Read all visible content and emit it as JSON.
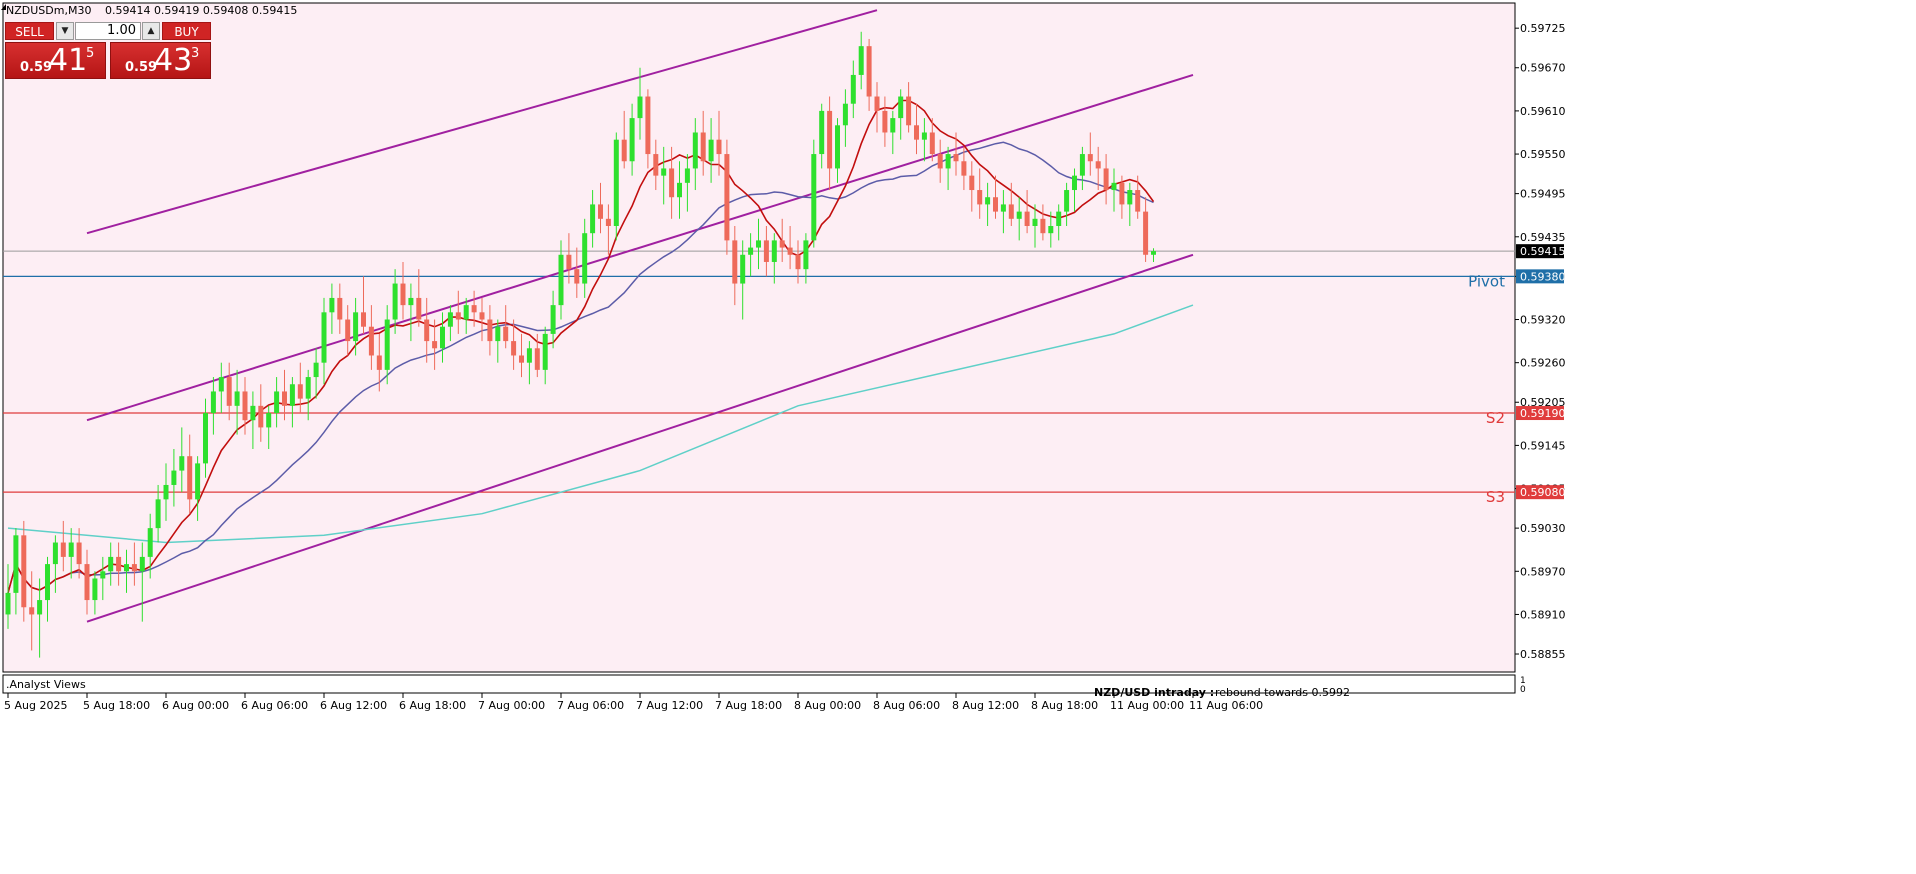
{
  "header": {
    "symbol": "NZDUSDm,M30",
    "ohlc": "0.59414 0.59419 0.59408 0.59415"
  },
  "trade_panel": {
    "sell_label": "SELL",
    "buy_label": "BUY",
    "lot": "1.00",
    "sell_small": "0.59",
    "sell_big": "41",
    "sell_sup": "5",
    "buy_small": "0.59",
    "buy_big": "43",
    "buy_sup": "3"
  },
  "footer": {
    "indicator_label": ".Analyst Views",
    "note_label": "NZD/USD intraday :",
    "note_text": "rebound towards 0.5992"
  },
  "colors": {
    "background": "#fdeef4",
    "bull": "#2ee02e",
    "bear": "#ee6a5a",
    "ma_fast": "#c20e0e",
    "ma_mid": "#5c5ca8",
    "ma_slow": "#5fd0c8",
    "channel": "#a020a0",
    "pivot": "#1f6fa8",
    "support": "#e03c3c",
    "grid_price_box": "#000000"
  },
  "chart_data": {
    "type": "candlestick",
    "symbol": "NZDUSDm",
    "timeframe": "M30",
    "ylim": [
      0.5883,
      0.5976
    ],
    "y_ticks": [
      "0.59725",
      "0.59670",
      "0.59610",
      "0.59550",
      "0.59495",
      "0.59435",
      "0.59380",
      "0.59320",
      "0.59260",
      "0.59205",
      "0.59145",
      "0.59085",
      "0.59030",
      "0.58970",
      "0.58910",
      "0.58855"
    ],
    "x_ticks": [
      {
        "i": 0,
        "label": "5 Aug 2025"
      },
      {
        "i": 10,
        "label": "5 Aug 18:00"
      },
      {
        "i": 20,
        "label": "6 Aug 00:00"
      },
      {
        "i": 30,
        "label": "6 Aug 06:00"
      },
      {
        "i": 40,
        "label": "6 Aug 12:00"
      },
      {
        "i": 50,
        "label": "6 Aug 18:00"
      },
      {
        "i": 60,
        "label": "7 Aug 00:00"
      },
      {
        "i": 70,
        "label": "7 Aug 06:00"
      },
      {
        "i": 80,
        "label": "7 Aug 12:00"
      },
      {
        "i": 90,
        "label": "7 Aug 18:00"
      },
      {
        "i": 100,
        "label": "8 Aug 00:00"
      },
      {
        "i": 110,
        "label": "8 Aug 06:00"
      },
      {
        "i": 120,
        "label": "8 Aug 12:00"
      },
      {
        "i": 130,
        "label": "8 Aug 18:00"
      },
      {
        "i": 140,
        "label": "11 Aug 00:00"
      },
      {
        "i": 150,
        "label": "11 Aug 06:00"
      }
    ],
    "candles": [
      [
        0.5891,
        0.5898,
        0.5889,
        0.5894
      ],
      [
        0.5894,
        0.5903,
        0.5891,
        0.5902
      ],
      [
        0.5902,
        0.5904,
        0.589,
        0.5892
      ],
      [
        0.5892,
        0.5897,
        0.5886,
        0.5891
      ],
      [
        0.5891,
        0.5896,
        0.5885,
        0.5893
      ],
      [
        0.5893,
        0.5899,
        0.589,
        0.5898
      ],
      [
        0.5898,
        0.5902,
        0.5894,
        0.5901
      ],
      [
        0.5901,
        0.5904,
        0.5897,
        0.5899
      ],
      [
        0.5899,
        0.5903,
        0.5896,
        0.5901
      ],
      [
        0.5901,
        0.5903,
        0.5896,
        0.5898
      ],
      [
        0.5898,
        0.59,
        0.5891,
        0.5893
      ],
      [
        0.5893,
        0.5897,
        0.5891,
        0.5896
      ],
      [
        0.5896,
        0.5899,
        0.5893,
        0.5897
      ],
      [
        0.5897,
        0.5901,
        0.5895,
        0.5899
      ],
      [
        0.5899,
        0.5901,
        0.5895,
        0.5897
      ],
      [
        0.5897,
        0.59,
        0.5894,
        0.5898
      ],
      [
        0.5898,
        0.5901,
        0.5895,
        0.5897
      ],
      [
        0.5897,
        0.5901,
        0.589,
        0.5899
      ],
      [
        0.5899,
        0.5905,
        0.5896,
        0.5903
      ],
      [
        0.5903,
        0.5909,
        0.5901,
        0.5907
      ],
      [
        0.5907,
        0.5912,
        0.5904,
        0.5909
      ],
      [
        0.5909,
        0.5914,
        0.5906,
        0.5911
      ],
      [
        0.5911,
        0.5917,
        0.5908,
        0.5913
      ],
      [
        0.5913,
        0.5916,
        0.5905,
        0.5907
      ],
      [
        0.5907,
        0.5913,
        0.5904,
        0.5912
      ],
      [
        0.5912,
        0.5921,
        0.591,
        0.5919
      ],
      [
        0.5919,
        0.5924,
        0.5916,
        0.5922
      ],
      [
        0.5922,
        0.5926,
        0.5919,
        0.5924
      ],
      [
        0.5924,
        0.5926,
        0.5918,
        0.592
      ],
      [
        0.592,
        0.5925,
        0.5916,
        0.5922
      ],
      [
        0.5922,
        0.5924,
        0.5916,
        0.5918
      ],
      [
        0.5918,
        0.5922,
        0.5914,
        0.592
      ],
      [
        0.592,
        0.5923,
        0.5915,
        0.5917
      ],
      [
        0.5917,
        0.592,
        0.5914,
        0.5919
      ],
      [
        0.5919,
        0.5924,
        0.5917,
        0.5922
      ],
      [
        0.5922,
        0.5925,
        0.5918,
        0.592
      ],
      [
        0.592,
        0.5924,
        0.5917,
        0.5923
      ],
      [
        0.5923,
        0.5926,
        0.5919,
        0.5921
      ],
      [
        0.5921,
        0.5925,
        0.5918,
        0.5924
      ],
      [
        0.5924,
        0.5928,
        0.5921,
        0.5926
      ],
      [
        0.5926,
        0.5935,
        0.5923,
        0.5933
      ],
      [
        0.5933,
        0.5937,
        0.593,
        0.5935
      ],
      [
        0.5935,
        0.5937,
        0.593,
        0.5932
      ],
      [
        0.5932,
        0.5934,
        0.5927,
        0.5929
      ],
      [
        0.5929,
        0.5935,
        0.5927,
        0.5933
      ],
      [
        0.5933,
        0.5938,
        0.593,
        0.5931
      ],
      [
        0.5931,
        0.5934,
        0.5925,
        0.5927
      ],
      [
        0.5927,
        0.593,
        0.5922,
        0.5925
      ],
      [
        0.5925,
        0.5934,
        0.5923,
        0.5932
      ],
      [
        0.5932,
        0.5939,
        0.593,
        0.5937
      ],
      [
        0.5937,
        0.594,
        0.5932,
        0.5934
      ],
      [
        0.5934,
        0.5937,
        0.5929,
        0.5935
      ],
      [
        0.5935,
        0.5939,
        0.5931,
        0.5932
      ],
      [
        0.5932,
        0.5935,
        0.5926,
        0.5929
      ],
      [
        0.5929,
        0.5932,
        0.5925,
        0.5928
      ],
      [
        0.5928,
        0.5933,
        0.5926,
        0.5931
      ],
      [
        0.5931,
        0.5934,
        0.5929,
        0.5933
      ],
      [
        0.5933,
        0.5936,
        0.593,
        0.5932
      ],
      [
        0.5932,
        0.5935,
        0.593,
        0.5934
      ],
      [
        0.5934,
        0.5936,
        0.5931,
        0.5933
      ],
      [
        0.5933,
        0.5935,
        0.5929,
        0.5932
      ],
      [
        0.5932,
        0.5934,
        0.5927,
        0.5929
      ],
      [
        0.5929,
        0.5932,
        0.5926,
        0.5931
      ],
      [
        0.5931,
        0.5934,
        0.5928,
        0.5929
      ],
      [
        0.5929,
        0.5932,
        0.5925,
        0.5927
      ],
      [
        0.5927,
        0.593,
        0.5924,
        0.5926
      ],
      [
        0.5926,
        0.5929,
        0.5923,
        0.5928
      ],
      [
        0.5928,
        0.593,
        0.5924,
        0.5925
      ],
      [
        0.5925,
        0.5931,
        0.5923,
        0.593
      ],
      [
        0.593,
        0.5936,
        0.5928,
        0.5934
      ],
      [
        0.5934,
        0.5943,
        0.5932,
        0.5941
      ],
      [
        0.5941,
        0.5944,
        0.5937,
        0.5939
      ],
      [
        0.5939,
        0.5942,
        0.5935,
        0.5937
      ],
      [
        0.5937,
        0.5946,
        0.5935,
        0.5944
      ],
      [
        0.5944,
        0.595,
        0.5942,
        0.5948
      ],
      [
        0.5948,
        0.5951,
        0.5944,
        0.5946
      ],
      [
        0.5946,
        0.5948,
        0.5941,
        0.5945
      ],
      [
        0.5945,
        0.5958,
        0.5943,
        0.5957
      ],
      [
        0.5957,
        0.5961,
        0.5953,
        0.5954
      ],
      [
        0.5954,
        0.5962,
        0.5952,
        0.596
      ],
      [
        0.596,
        0.5967,
        0.5957,
        0.5963
      ],
      [
        0.5963,
        0.5964,
        0.5953,
        0.5955
      ],
      [
        0.5955,
        0.5957,
        0.595,
        0.5952
      ],
      [
        0.5952,
        0.5956,
        0.5948,
        0.5953
      ],
      [
        0.5953,
        0.5956,
        0.5946,
        0.5949
      ],
      [
        0.5949,
        0.5954,
        0.5946,
        0.5951
      ],
      [
        0.5951,
        0.5955,
        0.5947,
        0.5953
      ],
      [
        0.5953,
        0.596,
        0.595,
        0.5958
      ],
      [
        0.5958,
        0.5961,
        0.5952,
        0.5954
      ],
      [
        0.5954,
        0.596,
        0.5951,
        0.5957
      ],
      [
        0.5957,
        0.5961,
        0.5952,
        0.5955
      ],
      [
        0.5955,
        0.5957,
        0.5941,
        0.5943
      ],
      [
        0.5943,
        0.5945,
        0.5934,
        0.5937
      ],
      [
        0.5937,
        0.5943,
        0.5932,
        0.5941
      ],
      [
        0.5941,
        0.5944,
        0.5938,
        0.5942
      ],
      [
        0.5942,
        0.5946,
        0.5939,
        0.5943
      ],
      [
        0.5943,
        0.5945,
        0.5938,
        0.594
      ],
      [
        0.594,
        0.5944,
        0.5937,
        0.5943
      ],
      [
        0.5943,
        0.5946,
        0.594,
        0.5942
      ],
      [
        0.5942,
        0.5945,
        0.5939,
        0.5941
      ],
      [
        0.5941,
        0.5943,
        0.5937,
        0.5939
      ],
      [
        0.5939,
        0.5944,
        0.5937,
        0.5943
      ],
      [
        0.5943,
        0.5957,
        0.5942,
        0.5955
      ],
      [
        0.5955,
        0.5962,
        0.5953,
        0.5961
      ],
      [
        0.5961,
        0.5963,
        0.595,
        0.5953
      ],
      [
        0.5953,
        0.596,
        0.5951,
        0.5959
      ],
      [
        0.5959,
        0.5964,
        0.5956,
        0.5962
      ],
      [
        0.5962,
        0.5968,
        0.596,
        0.5966
      ],
      [
        0.5966,
        0.5972,
        0.5964,
        0.597
      ],
      [
        0.597,
        0.5971,
        0.5961,
        0.5963
      ],
      [
        0.5963,
        0.5965,
        0.5958,
        0.5961
      ],
      [
        0.5961,
        0.5963,
        0.5956,
        0.5958
      ],
      [
        0.5958,
        0.5961,
        0.5955,
        0.596
      ],
      [
        0.596,
        0.5964,
        0.5957,
        0.5963
      ],
      [
        0.5963,
        0.5965,
        0.5958,
        0.5959
      ],
      [
        0.5959,
        0.5962,
        0.5955,
        0.5957
      ],
      [
        0.5957,
        0.596,
        0.5954,
        0.5958
      ],
      [
        0.5958,
        0.596,
        0.5954,
        0.5955
      ],
      [
        0.5955,
        0.5957,
        0.5951,
        0.5953
      ],
      [
        0.5953,
        0.5956,
        0.595,
        0.5955
      ],
      [
        0.5955,
        0.5958,
        0.5952,
        0.5954
      ],
      [
        0.5954,
        0.5956,
        0.595,
        0.5952
      ],
      [
        0.5952,
        0.5954,
        0.5947,
        0.595
      ],
      [
        0.595,
        0.5953,
        0.5946,
        0.5948
      ],
      [
        0.5948,
        0.5951,
        0.5945,
        0.5949
      ],
      [
        0.5949,
        0.5952,
        0.5946,
        0.5947
      ],
      [
        0.5947,
        0.595,
        0.5944,
        0.5948
      ],
      [
        0.5948,
        0.5951,
        0.5945,
        0.5946
      ],
      [
        0.5946,
        0.5949,
        0.5943,
        0.5947
      ],
      [
        0.5947,
        0.595,
        0.5944,
        0.5945
      ],
      [
        0.5945,
        0.5948,
        0.5942,
        0.5946
      ],
      [
        0.5946,
        0.5948,
        0.5943,
        0.5944
      ],
      [
        0.5944,
        0.5947,
        0.5942,
        0.5945
      ],
      [
        0.5945,
        0.5948,
        0.5943,
        0.5947
      ],
      [
        0.5947,
        0.5951,
        0.5945,
        0.595
      ],
      [
        0.595,
        0.5953,
        0.5947,
        0.5952
      ],
      [
        0.5952,
        0.5956,
        0.595,
        0.5955
      ],
      [
        0.5955,
        0.5958,
        0.5952,
        0.5954
      ],
      [
        0.5954,
        0.5956,
        0.595,
        0.5953
      ],
      [
        0.5953,
        0.5955,
        0.5948,
        0.595
      ],
      [
        0.595,
        0.5953,
        0.5947,
        0.5951
      ],
      [
        0.5951,
        0.5952,
        0.5946,
        0.5948
      ],
      [
        0.5948,
        0.5951,
        0.5945,
        0.595
      ],
      [
        0.595,
        0.5952,
        0.5946,
        0.5947
      ],
      [
        0.5947,
        0.5949,
        0.594,
        0.5941
      ],
      [
        0.5941,
        0.59419,
        0.594,
        0.59415
      ]
    ],
    "moving_averages": [
      {
        "name": "fast",
        "period": 21,
        "color": "#c20e0e"
      },
      {
        "name": "mid",
        "period": 55,
        "color": "#5c5ca8"
      },
      {
        "name": "slow",
        "period": 200,
        "color": "#5fd0c8"
      }
    ],
    "slow_ma_points": [
      [
        0,
        0.5903
      ],
      [
        20,
        0.5901
      ],
      [
        40,
        0.5902
      ],
      [
        60,
        0.5905
      ],
      [
        80,
        0.5911
      ],
      [
        100,
        0.592
      ],
      [
        120,
        0.5925
      ],
      [
        140,
        0.593
      ],
      [
        150,
        0.5934
      ]
    ],
    "channel": {
      "upper": [
        [
          10,
          0.5944
        ],
        [
          110,
          0.5975
        ]
      ],
      "middle": [
        [
          10,
          0.5918
        ],
        [
          150,
          0.5966
        ]
      ],
      "lower": [
        [
          10,
          0.589
        ],
        [
          150,
          0.5941
        ]
      ]
    },
    "levels": [
      {
        "name": "Pivot",
        "value": 0.5938,
        "value_label": "0.59380",
        "color": "#1f6fa8"
      },
      {
        "name": "S2",
        "value": 0.5919,
        "value_label": "0.59190",
        "color": "#e03c3c"
      },
      {
        "name": "S3",
        "value": 0.5908,
        "value_label": "0.59080",
        "color": "#e03c3c"
      }
    ],
    "current_price": {
      "value": 0.59415,
      "label": "0.59415"
    },
    "subwindow": {
      "scale_top": "1",
      "scale_bottom": "0"
    }
  }
}
